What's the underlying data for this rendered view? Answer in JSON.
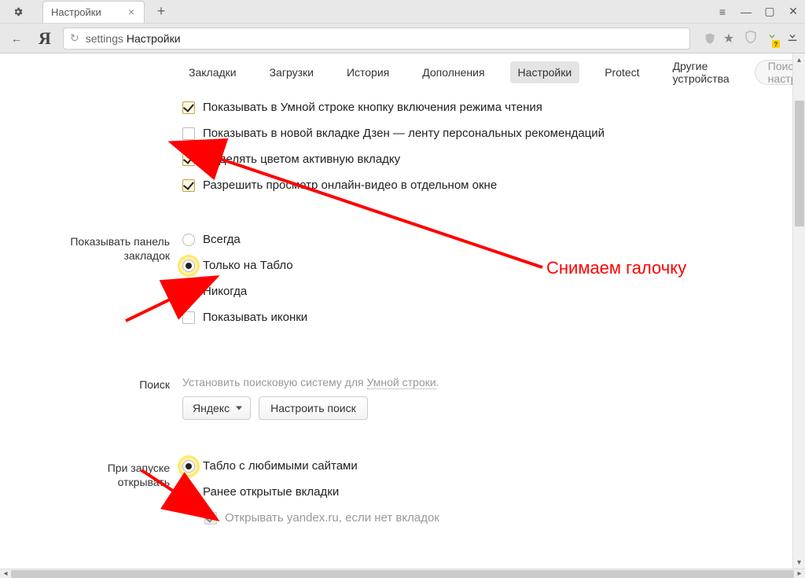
{
  "window": {
    "tab_title": "Настройки",
    "menu_icon": "≡",
    "min_icon": "—",
    "max_icon": "▢",
    "close_icon": "✕",
    "newtab_icon": "+",
    "tab_close_icon": "×"
  },
  "toolbar": {
    "back_icon": "←",
    "logo": "Я",
    "reload_icon": "↻",
    "url_prefix": "settings",
    "url_title": "Настройки"
  },
  "nav": {
    "items": [
      "Закладки",
      "Загрузки",
      "История",
      "Дополнения",
      "Настройки",
      "Protect",
      "Другие устройства"
    ],
    "active_index": 4,
    "search_placeholder": "Поиск настроек"
  },
  "top_section": {
    "checks": [
      {
        "label": "Показывать в Умной строке кнопку включения режима чтения",
        "checked": true
      },
      {
        "label": "Показывать в новой вкладке Дзен — ленту персональных рекомендаций",
        "checked": false,
        "plain": true
      },
      {
        "label": "Выделять цветом активную вкладку",
        "checked": true
      },
      {
        "label": "Разрешить просмотр онлайн-видео в отдельном окне",
        "checked": true
      }
    ]
  },
  "bookmarks_panel": {
    "label_l1": "Показывать панель",
    "label_l2": "закладок",
    "radios": [
      {
        "label": "Всегда",
        "checked": false
      },
      {
        "label": "Только на Табло",
        "checked": true
      },
      {
        "label": "Никогда",
        "checked": false
      }
    ],
    "show_icons": {
      "label": "Показывать иконки",
      "checked": false
    }
  },
  "search_section": {
    "label": "Поиск",
    "desc_prefix": "Установить поисковую систему для ",
    "desc_link": "Умной строки",
    "desc_suffix": ".",
    "select_value": "Яндекс",
    "button_label": "Настроить поиск"
  },
  "startup_section": {
    "label_l1": "При запуске",
    "label_l2": "открывать",
    "radios": [
      {
        "label": "Табло с любимыми сайтами",
        "checked": true
      },
      {
        "label": "Ранее открытые вкладки",
        "checked": false
      }
    ],
    "sub_check": {
      "label": "Открывать yandex.ru, если нет вкладок",
      "checked": true,
      "disabled": true
    }
  },
  "annotation": {
    "note": "Снимаем галочку"
  }
}
